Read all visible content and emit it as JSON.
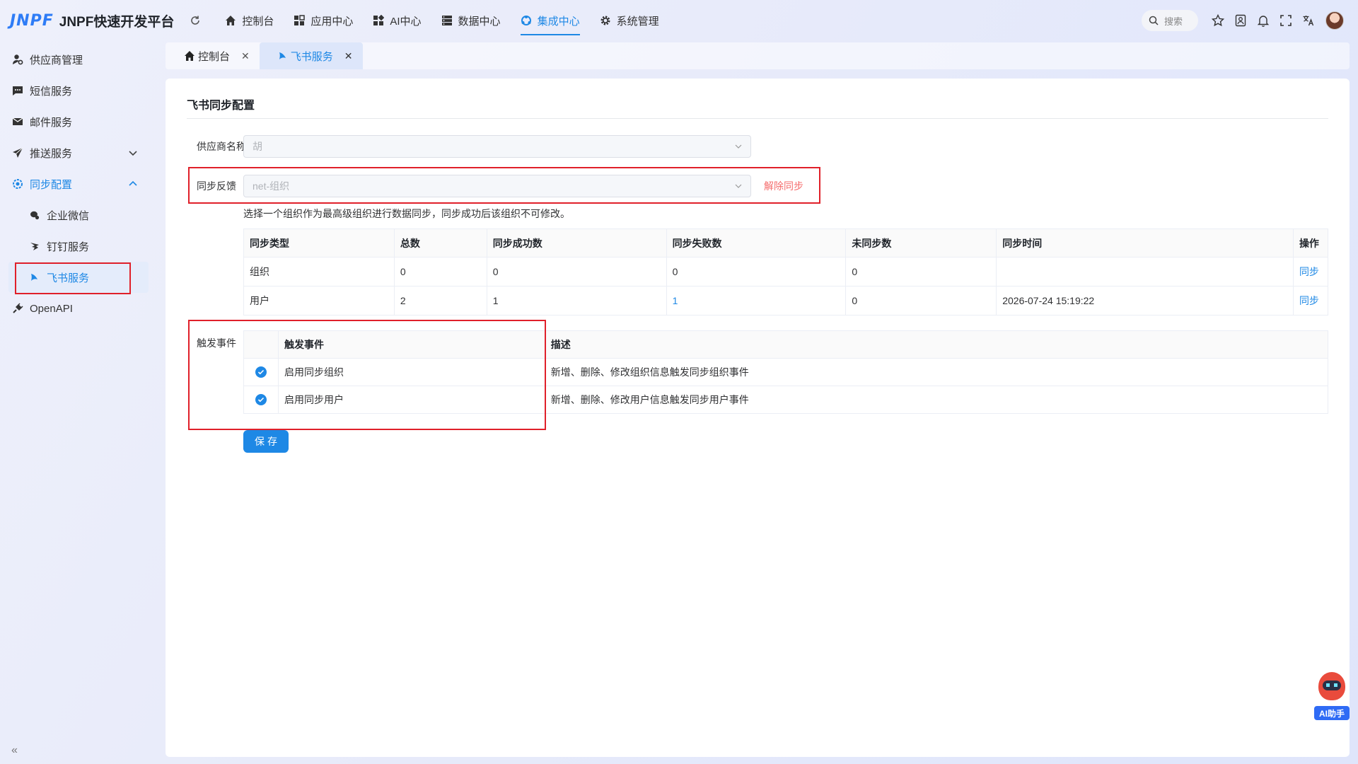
{
  "app": {
    "logo": "JNPF",
    "title": "JNPF快速开发平台"
  },
  "topnav": [
    {
      "label": "控制台",
      "icon": "home-icon"
    },
    {
      "label": "应用中心",
      "icon": "grid-icon"
    },
    {
      "label": "AI中心",
      "icon": "apps-icon"
    },
    {
      "label": "数据中心",
      "icon": "database-icon"
    },
    {
      "label": "集成中心",
      "icon": "integration-icon",
      "active": true
    },
    {
      "label": "系统管理",
      "icon": "gear-icon"
    }
  ],
  "header": {
    "search_placeholder": "搜索"
  },
  "sidebar": {
    "items": [
      {
        "label": "供应商管理"
      },
      {
        "label": "短信服务"
      },
      {
        "label": "邮件服务"
      },
      {
        "label": "推送服务"
      },
      {
        "label": "同步配置"
      },
      {
        "label": "企业微信"
      },
      {
        "label": "钉钉服务"
      },
      {
        "label": "飞书服务"
      },
      {
        "label": "OpenAPI"
      }
    ]
  },
  "tabs": [
    {
      "label": "控制台"
    },
    {
      "label": "飞书服务"
    }
  ],
  "main": {
    "title": "飞书同步配置",
    "supplier": {
      "label": "供应商名称",
      "value": "胡"
    },
    "feedback": {
      "label": "同步反馈",
      "value": "net-组织",
      "unsync": "解除同步"
    },
    "hint": "选择一个组织作为最高级组织进行数据同步，同步成功后该组织不可修改。",
    "sync_table": {
      "headers": [
        "同步类型",
        "总数",
        "同步成功数",
        "同步失败数",
        "未同步数",
        "同步时间",
        "操作"
      ],
      "rows": [
        [
          "组织",
          "0",
          "0",
          "0",
          "0",
          "",
          "同步"
        ],
        [
          "用户",
          "2",
          "1",
          "1",
          "0",
          "2026-07-24 15:19:22",
          "同步"
        ]
      ]
    },
    "events": {
      "label": "触发事件",
      "headers": [
        "触发事件",
        "描述"
      ],
      "rows": [
        {
          "name": "启用同步组织",
          "desc": "新增、删除、修改组织信息触发同步组织事件",
          "checked": true
        },
        {
          "name": "启用同步用户",
          "desc": "新增、删除、修改用户信息触发同步用户事件",
          "checked": true
        }
      ]
    },
    "save": "保存"
  },
  "ai": {
    "label": "AI助手"
  },
  "colors": {
    "accent": "#1e88e5",
    "danger": "#f56c6c",
    "highlight": "#e0202a"
  }
}
